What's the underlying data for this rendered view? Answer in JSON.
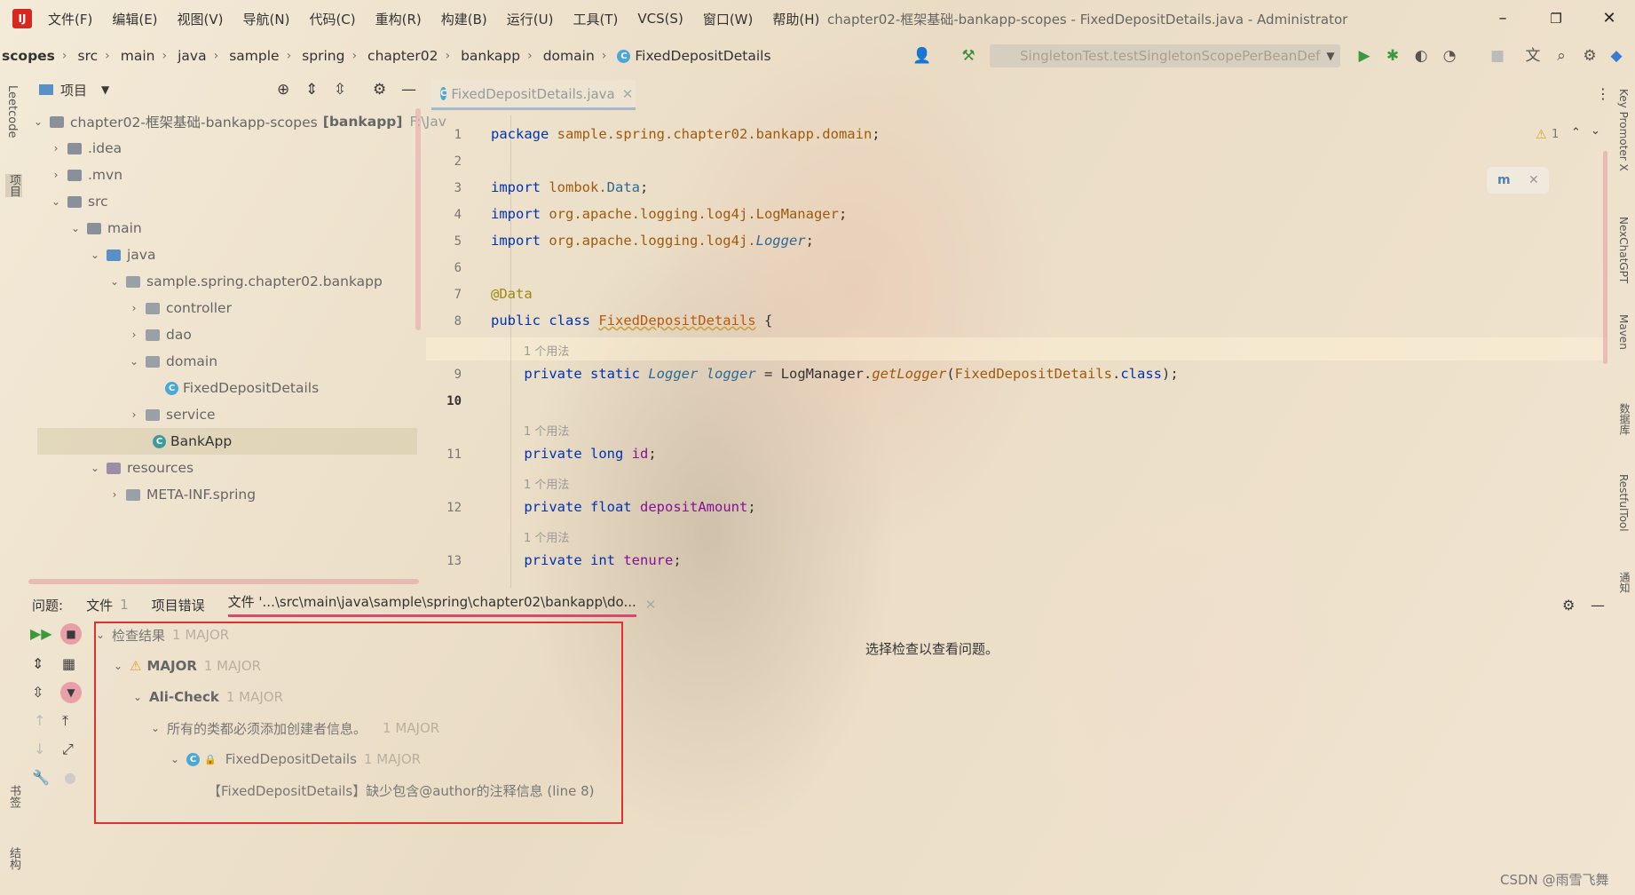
{
  "window": {
    "title": "chapter02-框架基础-bankapp-scopes - FixedDepositDetails.java - Administrator"
  },
  "menu": [
    "文件(F)",
    "编辑(E)",
    "视图(V)",
    "导航(N)",
    "代码(C)",
    "重构(R)",
    "构建(B)",
    "运行(U)",
    "工具(T)",
    "VCS(S)",
    "窗口(W)",
    "帮助(H)"
  ],
  "breadcrumb": [
    "scopes",
    "src",
    "main",
    "java",
    "sample",
    "spring",
    "chapter02",
    "bankapp",
    "domain",
    "FixedDepositDetails"
  ],
  "run_config": "SingletonTest.testSingletonScopePerBeanDef",
  "left_strip": {
    "leetcode": "Leetcode",
    "project": "项目",
    "bookmarks": "书签",
    "structure": "结构"
  },
  "right_strip": {
    "key_promoter": "Key Promoter X",
    "nexchat": "NexChatGPT",
    "maven": "Maven",
    "database": "数据库",
    "restful": "RestfulTool",
    "notifications": "通知"
  },
  "project_panel": {
    "title": "项目",
    "tree": [
      {
        "label": "chapter02-框架基础-bankapp-scopes",
        "suffix": "[bankapp]",
        "path": "F:\\Jav"
      },
      {
        "label": ".idea"
      },
      {
        "label": ".mvn"
      },
      {
        "label": "src"
      },
      {
        "label": "main"
      },
      {
        "label": "java"
      },
      {
        "label": "sample.spring.chapter02.bankapp"
      },
      {
        "label": "controller"
      },
      {
        "label": "dao"
      },
      {
        "label": "domain"
      },
      {
        "label": "FixedDepositDetails"
      },
      {
        "label": "service"
      },
      {
        "label": "BankApp"
      },
      {
        "label": "resources"
      },
      {
        "label": "META-INF.spring"
      }
    ]
  },
  "editor": {
    "tab": "FixedDepositDetails.java",
    "warning_count": "1",
    "lines": [
      {
        "no": "1",
        "code": "package sample.spring.chapter02.bankapp.domain;"
      },
      {
        "no": "2",
        "code": ""
      },
      {
        "no": "3",
        "code": "import lombok.Data;"
      },
      {
        "no": "4",
        "code": "import org.apache.logging.log4j.LogManager;"
      },
      {
        "no": "5",
        "code": "import org.apache.logging.log4j.Logger;"
      },
      {
        "no": "6",
        "code": ""
      },
      {
        "no": "7",
        "code": "@Data"
      },
      {
        "no": "8",
        "code": "public class FixedDepositDetails {"
      },
      {
        "no": "9",
        "code": "    private static Logger logger = LogManager.getLogger(FixedDepositDetails.class);"
      },
      {
        "no": "10",
        "code": ""
      },
      {
        "no": "11",
        "code": "    private long id;"
      },
      {
        "no": "12",
        "code": "    private float depositAmount;"
      },
      {
        "no": "13",
        "code": "    private int tenure;"
      }
    ],
    "usage_hint": "1 个用法"
  },
  "problems": {
    "label": "问题:",
    "tabs": [
      "文件",
      "项目错误",
      "文件 '...\\src\\main\\java\\sample\\spring\\chapter02\\bankapp\\do..."
    ],
    "file_count": "1",
    "tree": {
      "root": "检查结果",
      "root_count": "1 MAJOR",
      "severity": "MAJOR",
      "severity_count": "1 MAJOR",
      "group": "Ali-Check",
      "group_count": "1 MAJOR",
      "rule": "所有的类都必须添加创建者信息。",
      "rule_count": "1 MAJOR",
      "file": "FixedDepositDetails",
      "file_count": "1 MAJOR",
      "message": "【FixedDepositDetails】缺少包含@author的注释信息 (line 8)"
    },
    "detail_placeholder": "选择检查以查看问题。"
  },
  "watermark": "CSDN @雨雪飞舞",
  "colors": {
    "highlight_box": "#e03030",
    "active_tab_underline": "#d84870"
  }
}
